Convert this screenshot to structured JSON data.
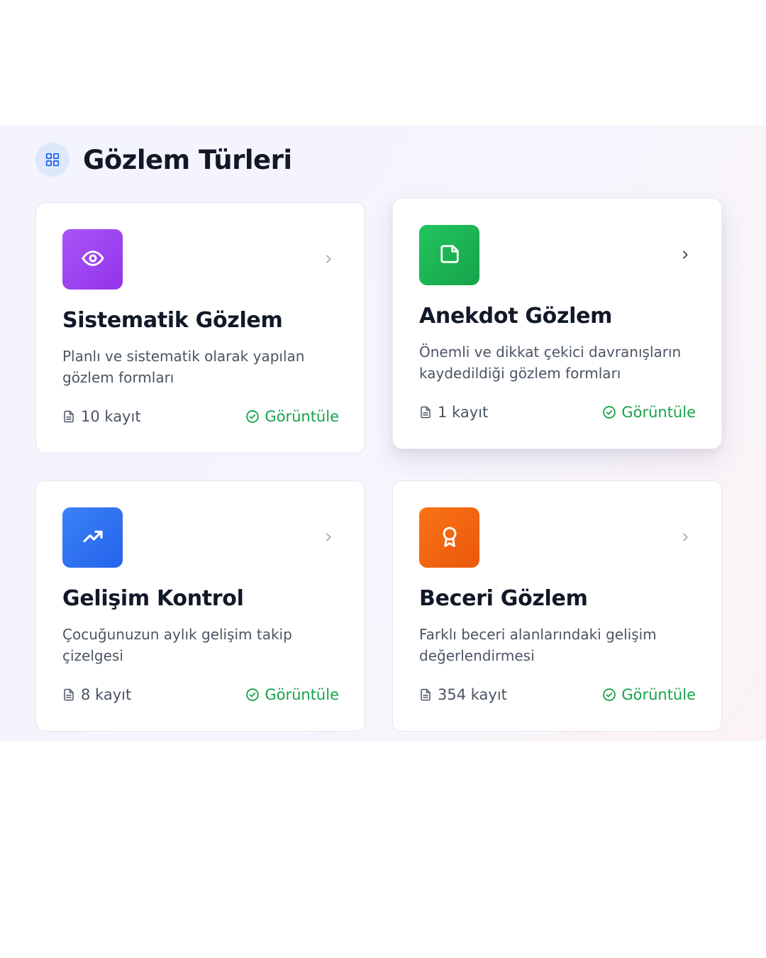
{
  "page": {
    "title": "Gözlem Türleri"
  },
  "cards": [
    {
      "title": "Sistematik Gözlem",
      "description": "Planlı ve sistematik olarak yapılan gözlem formları",
      "count": "10 kayıt",
      "action": "Görüntüle",
      "icon": "eye-icon",
      "color_from": "#a855f7",
      "color_to": "#9333ea"
    },
    {
      "title": "Anekdot Gözlem",
      "description": "Önemli ve dikkat çekici davranışların kaydedildiği gözlem formları",
      "count": "1 kayıt",
      "action": "Görüntüle",
      "icon": "sticky-note-icon",
      "color_from": "#22c55e",
      "color_to": "#16a34a"
    },
    {
      "title": "Gelişim Kontrol",
      "description": "Çocuğunuzun aylık gelişim takip çizelgesi",
      "count": "8 kayıt",
      "action": "Görüntüle",
      "icon": "trending-up-icon",
      "color_from": "#3b82f6",
      "color_to": "#2563eb"
    },
    {
      "title": "Beceri Gözlem",
      "description": "Farklı beceri alanlarındaki gelişim değerlendirmesi",
      "count": "354 kayıt",
      "action": "Görüntüle",
      "icon": "award-icon",
      "color_from": "#f97316",
      "color_to": "#ea580c"
    }
  ],
  "colors": {
    "accent_green": "#16a34a",
    "header_icon_bg": "#dde9fb",
    "header_icon": "#2563eb"
  }
}
